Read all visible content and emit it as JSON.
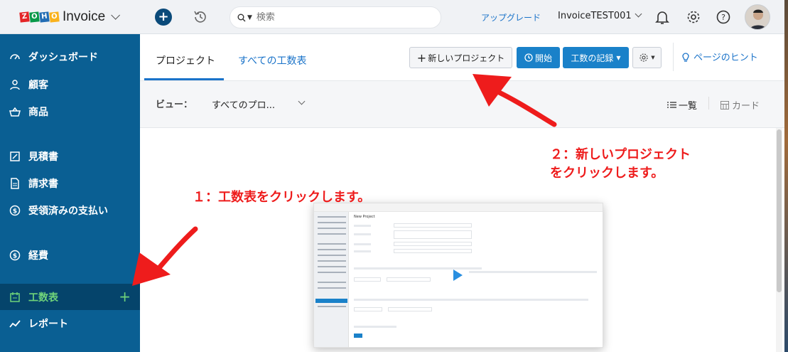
{
  "brand": {
    "name": "Invoice",
    "logo_letters": [
      "Z",
      "O",
      "H",
      "O"
    ],
    "logo_colors": [
      "#e42527",
      "#089949",
      "#226db4",
      "#f9b21d"
    ]
  },
  "sidebar": {
    "items": [
      {
        "label": "ダッシュボード",
        "icon": "dashboard-icon"
      },
      {
        "label": "顧客",
        "icon": "user-icon"
      },
      {
        "label": "商品",
        "icon": "basket-icon"
      },
      {
        "label": "見積書",
        "icon": "estimate-icon"
      },
      {
        "label": "請求書",
        "icon": "invoice-icon"
      },
      {
        "label": "受領済みの支払い",
        "icon": "payment-icon"
      },
      {
        "label": "経費",
        "icon": "expense-icon"
      },
      {
        "label": "工数表",
        "icon": "timesheet-icon",
        "active": true,
        "plus": "+"
      },
      {
        "label": "レポート",
        "icon": "reports-icon"
      }
    ]
  },
  "topbar": {
    "quick_add": "+",
    "search_placeholder": "検索",
    "upgrade": "アップグレード",
    "org_name": "InvoiceTEST001"
  },
  "tabs": {
    "projects": "プロジェクト",
    "timesheets": "すべての工数表"
  },
  "actions": {
    "new_project": "新しいプロジェクト",
    "start": "開始",
    "log_time": "工数の記録",
    "page_hints": "ページのヒント"
  },
  "filter": {
    "view_label": "ビュー：",
    "view_value": "すべてのプロ...",
    "list": "一覧",
    "card": "カード"
  },
  "annotations": {
    "step1": "１：工数表をクリックします。",
    "step2_line1": "２：新しいプロジェクト",
    "step2_line2": "をクリックします。"
  },
  "preview": {
    "title": "New Project"
  },
  "colors": {
    "sidebar": "#0a5f93",
    "accent": "#1a81c9",
    "active_text": "#6fd37a",
    "annotation": "#ee1c1c"
  }
}
